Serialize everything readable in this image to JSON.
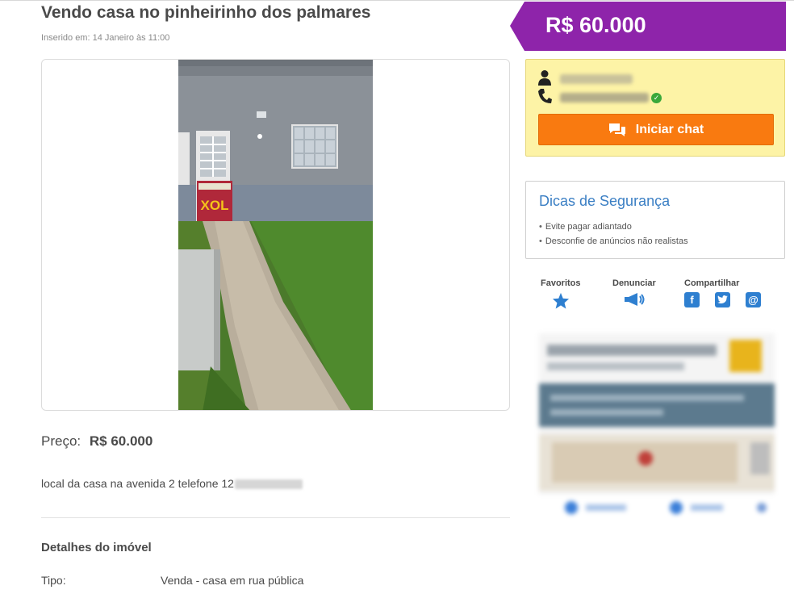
{
  "listing": {
    "title": "Vendo casa no pinheirinho dos palmares",
    "inserted": "Inserido em: 14 Janeiro às 11:00",
    "price_label": "Preço:",
    "price_value": "R$ 60.000",
    "description": "local da casa na avenida 2 telefone 12"
  },
  "details": {
    "title": "Detalhes do imóvel",
    "rows": [
      {
        "key": "Tipo:",
        "value": "Venda - casa em rua pública"
      }
    ]
  },
  "sidebar": {
    "price_banner": "R$ 60.000",
    "chat_button": "Iniciar chat",
    "safety": {
      "title": "Dicas de Segurança",
      "tips": [
        "Evite pagar adiantado",
        "Desconfie de anúncios não realistas"
      ]
    },
    "actions": {
      "favorites": "Favoritos",
      "report": "Denunciar",
      "share": "Compartilhar"
    }
  },
  "colors": {
    "banner_purple": "#8e24aa",
    "chat_orange": "#f97a10",
    "contact_yellow": "#fdf3a6",
    "link_blue": "#3b7fc4",
    "icon_blue": "#2e7fd0"
  },
  "icons": {
    "person": "person-icon",
    "phone": "phone-icon",
    "verified": "verified-check-icon",
    "chat": "chat-bubbles-icon",
    "star": "star-icon",
    "megaphone": "megaphone-icon",
    "facebook": "facebook-icon",
    "twitter": "twitter-icon",
    "email": "email-at-icon"
  }
}
